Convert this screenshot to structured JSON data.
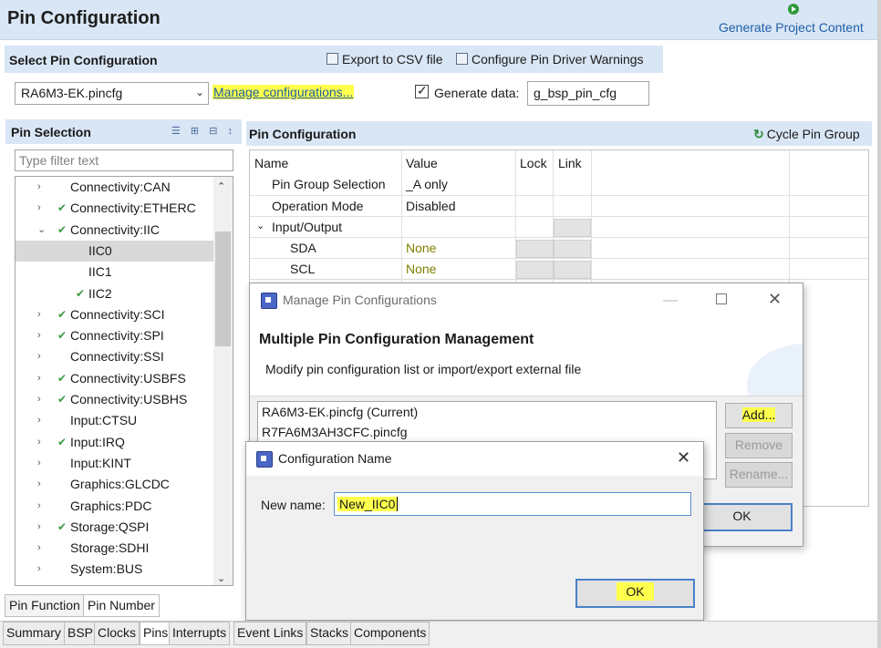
{
  "header": {
    "title": "Pin Configuration",
    "generate_label": "Generate Project Content"
  },
  "select_bar": {
    "title": "Select Pin Configuration",
    "export_label": "Export to CSV file",
    "warnings_label": "Configure Pin Driver Warnings",
    "config_value": "RA6M3-EK.pincfg",
    "manage_link": "Manage configurations...",
    "generate_label": "Generate data:",
    "generate_value": "g_bsp_pin_cfg"
  },
  "pin_selection": {
    "title": "Pin Selection",
    "filter_placeholder": "Type filter text",
    "items": [
      {
        "label": "Connectivity:CAN",
        "arrow": "›",
        "check": false,
        "level": 0
      },
      {
        "label": "Connectivity:ETHERC",
        "arrow": "›",
        "check": true,
        "level": 0
      },
      {
        "label": "Connectivity:IIC",
        "arrow": "⌄",
        "check": true,
        "level": 0
      },
      {
        "label": "IIC0",
        "arrow": "",
        "check": false,
        "level": 1,
        "selected": true
      },
      {
        "label": "IIC1",
        "arrow": "",
        "check": false,
        "level": 1
      },
      {
        "label": "IIC2",
        "arrow": "",
        "check": true,
        "level": 1
      },
      {
        "label": "Connectivity:SCI",
        "arrow": "›",
        "check": true,
        "level": 0
      },
      {
        "label": "Connectivity:SPI",
        "arrow": "›",
        "check": true,
        "level": 0
      },
      {
        "label": "Connectivity:SSI",
        "arrow": "›",
        "check": false,
        "level": 0
      },
      {
        "label": "Connectivity:USBFS",
        "arrow": "›",
        "check": true,
        "level": 0
      },
      {
        "label": "Connectivity:USBHS",
        "arrow": "›",
        "check": true,
        "level": 0
      },
      {
        "label": "Input:CTSU",
        "arrow": "›",
        "check": false,
        "level": 0
      },
      {
        "label": "Input:IRQ",
        "arrow": "›",
        "check": true,
        "level": 0
      },
      {
        "label": "Input:KINT",
        "arrow": "›",
        "check": false,
        "level": 0
      },
      {
        "label": "Graphics:GLCDC",
        "arrow": "›",
        "check": false,
        "level": 0
      },
      {
        "label": "Graphics:PDC",
        "arrow": "›",
        "check": false,
        "level": 0
      },
      {
        "label": "Storage:QSPI",
        "arrow": "›",
        "check": true,
        "level": 0
      },
      {
        "label": "Storage:SDHI",
        "arrow": "›",
        "check": false,
        "level": 0
      },
      {
        "label": "System:BUS",
        "arrow": "›",
        "check": false,
        "level": 0
      }
    ],
    "tabs": [
      "Pin Function",
      "Pin Number"
    ]
  },
  "pin_config": {
    "title": "Pin Configuration",
    "cycle_label": "Cycle Pin Group",
    "columns": [
      "Name",
      "Value",
      "Lock",
      "Link"
    ],
    "rows": [
      {
        "name": "Pin Group Selection",
        "value": "_A only"
      },
      {
        "name": "Operation Mode",
        "value": "Disabled"
      },
      {
        "name": "Input/Output",
        "value": ""
      },
      {
        "name": "SDA",
        "value": "None"
      },
      {
        "name": "SCL",
        "value": "None"
      }
    ]
  },
  "manage_dialog": {
    "title": "Manage Pin Configurations",
    "heading": "Multiple Pin Configuration Management",
    "subtitle": "Modify pin configuration list or import/export external file",
    "list": [
      "RA6M3-EK.pincfg (Current)",
      "R7FA6M3AH3CFC.pincfg"
    ],
    "add": "Add...",
    "remove": "Remove",
    "rename": "Rename...",
    "ok": "OK"
  },
  "name_dialog": {
    "title": "Configuration Name",
    "label": "New name:",
    "value": "New_IIC0",
    "ok": "OK"
  },
  "bottom_tabs": [
    "Summary",
    "BSP",
    "Clocks",
    "Pins",
    "Interrupts",
    "Event Links",
    "Stacks",
    "Components"
  ],
  "colors": {
    "accent": "#1e5fa8",
    "highlight": "#ffff4d",
    "panel_header": "#d9e6f5",
    "check": "#3b9b45"
  }
}
